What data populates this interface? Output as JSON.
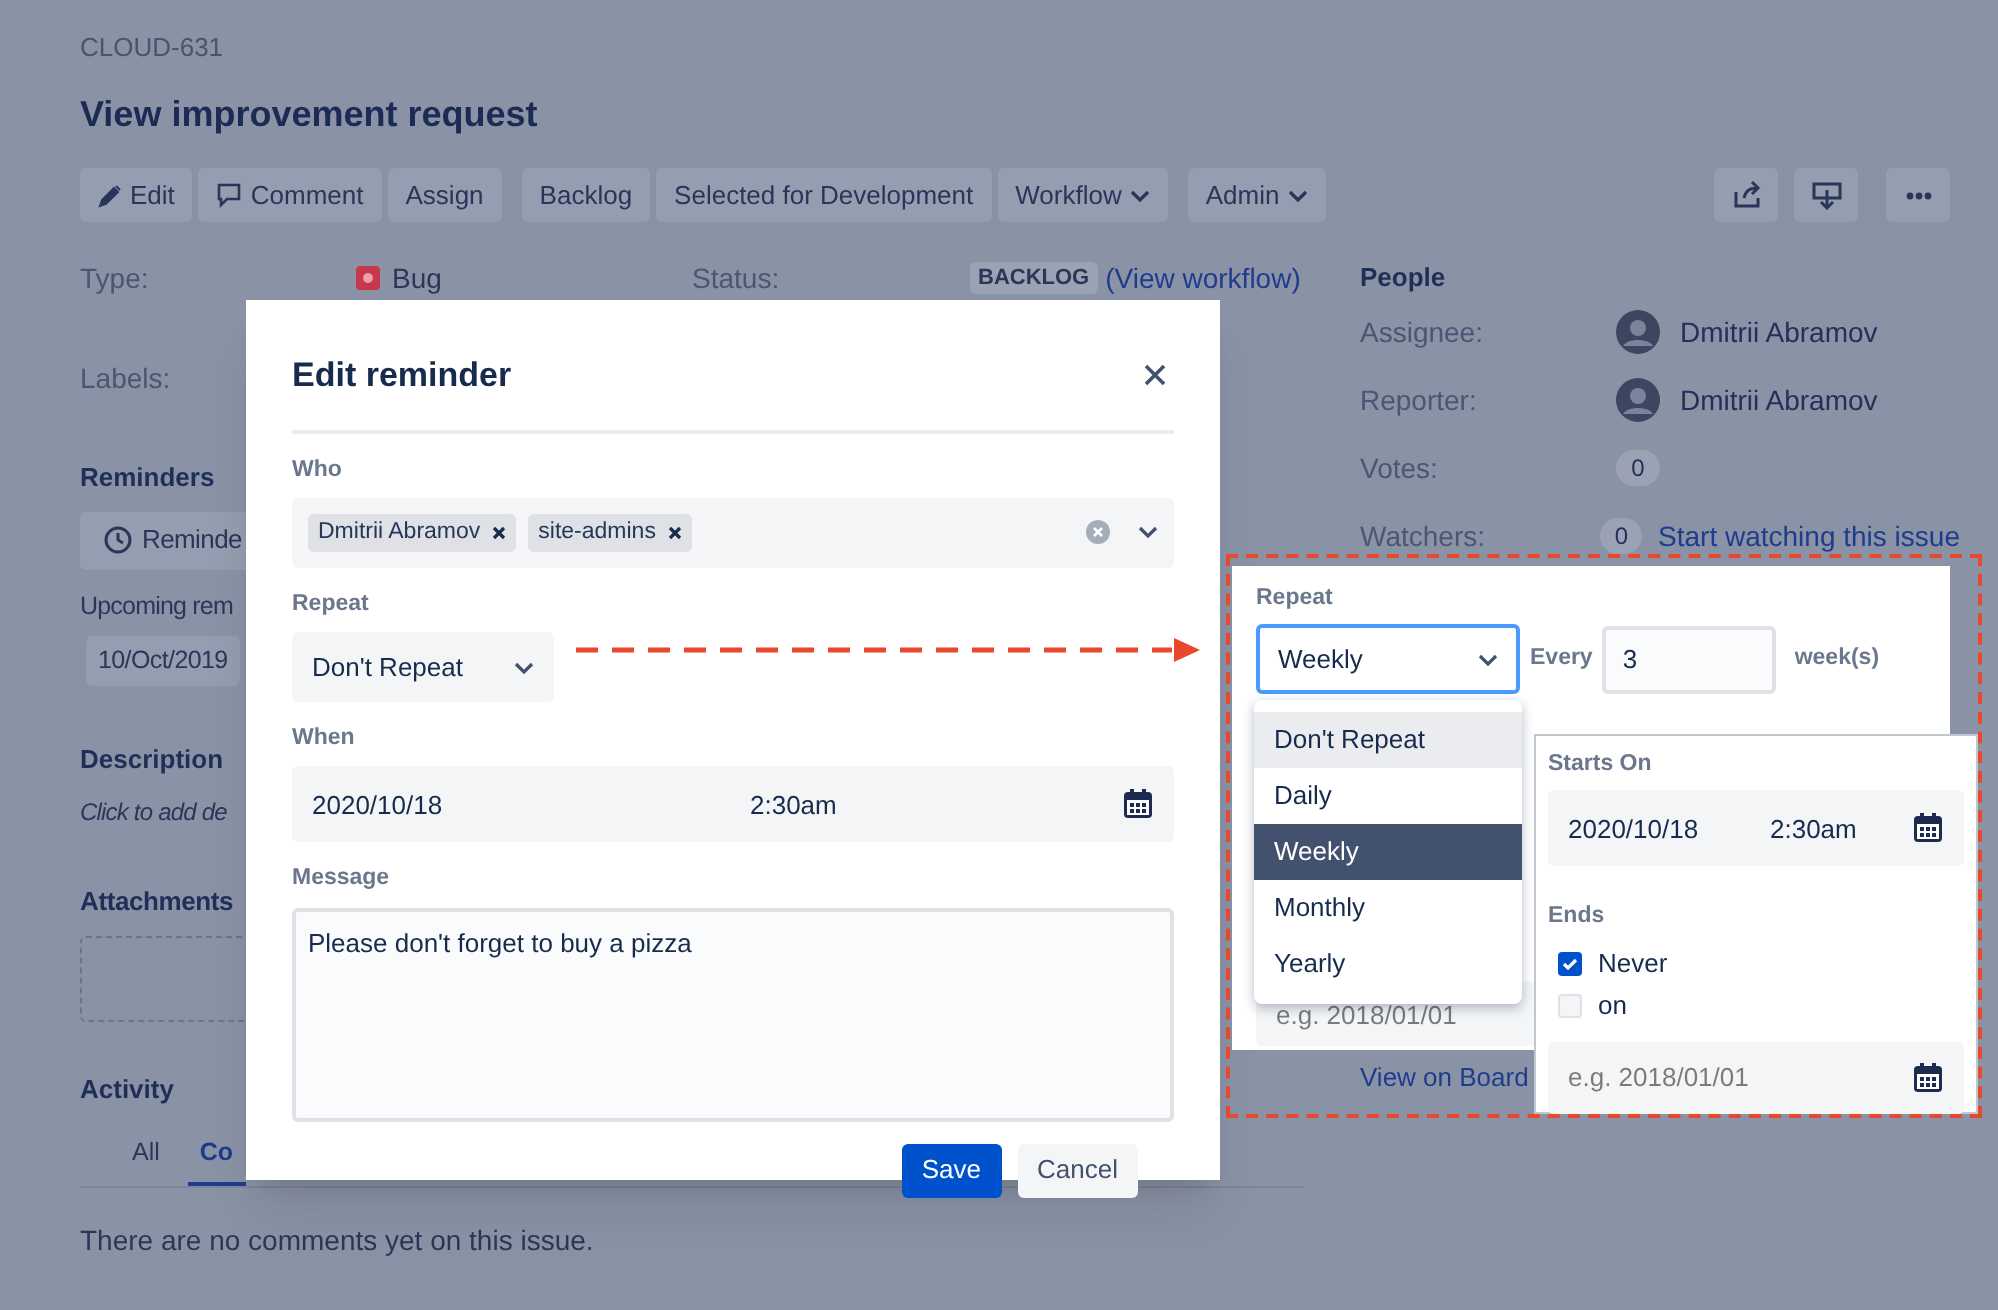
{
  "issue": {
    "key": "CLOUD-631",
    "title": "View improvement request"
  },
  "toolbar_groups": [
    [
      {
        "label": "Edit",
        "dropdown": false
      },
      {
        "label": "Comment",
        "dropdown": false
      },
      {
        "label": "Assign",
        "dropdown": false
      }
    ],
    [
      {
        "label": "Backlog",
        "dropdown": false
      },
      {
        "label": "Selected for Development",
        "dropdown": false
      },
      {
        "label": "Workflow",
        "dropdown": true
      }
    ],
    [
      {
        "label": "Admin",
        "dropdown": true
      }
    ]
  ],
  "fields": {
    "type": {
      "label": "Type:",
      "value": "Bug"
    },
    "status": {
      "label": "Status:",
      "badge": "BACKLOG",
      "link": "(View workflow)"
    },
    "labels": {
      "label": "Labels:"
    }
  },
  "reminders": {
    "heading": "Reminders",
    "button": "Reminde",
    "upcoming_label": "Upcoming rem",
    "upcoming_date": "10/Oct/2019"
  },
  "description": {
    "heading": "Description",
    "prompt": "Click to add de"
  },
  "attachments": {
    "heading": "Attachments"
  },
  "activity": {
    "heading": "Activity",
    "tabs": [
      {
        "label": "All",
        "selected": false
      },
      {
        "label": "Co",
        "selected": true
      }
    ],
    "empty_text": "There are no comments yet on this issue."
  },
  "people": {
    "heading": "People",
    "rows": [
      {
        "label": "Assignee:",
        "kind": "user",
        "value": "Dmitrii Abramov"
      },
      {
        "label": "Reporter:",
        "kind": "user",
        "value": "Dmitrii Abramov"
      },
      {
        "label": "Votes:",
        "kind": "count",
        "value": "0"
      },
      {
        "label": "Watchers:",
        "kind": "count",
        "value": "0",
        "link": "Start watching this issue"
      }
    ]
  },
  "modal": {
    "title": "Edit reminder",
    "who": {
      "label": "Who",
      "chips": [
        "Dmitrii Abramov",
        "site-admins"
      ]
    },
    "repeat": {
      "label": "Repeat",
      "value": "Don't Repeat"
    },
    "when": {
      "label": "When",
      "date": "2020/10/18",
      "time": "2:30am"
    },
    "message": {
      "label": "Message",
      "value": "Please don't forget to buy a pizza"
    },
    "buttons": [
      {
        "label": "Save",
        "kind": "primary"
      },
      {
        "label": "Cancel",
        "kind": "secondary"
      }
    ]
  },
  "callout": {
    "repeat_label": "Repeat",
    "repeat_value": "Weekly",
    "every_label": "Every",
    "every_value": "3",
    "unit": "week(s)",
    "options": [
      {
        "label": "Don't Repeat",
        "selected": false,
        "hovered": true
      },
      {
        "label": "Daily",
        "selected": false,
        "hovered": false
      },
      {
        "label": "Weekly",
        "selected": true,
        "hovered": false
      },
      {
        "label": "Monthly",
        "selected": false,
        "hovered": false
      },
      {
        "label": "Yearly",
        "selected": false,
        "hovered": false
      }
    ],
    "date_placeholder": "e.g. 2018/01/01",
    "link": "View on Board",
    "schedule": {
      "starts_label": "Starts On",
      "date": "2020/10/18",
      "time": "2:30am",
      "ends_label": "Ends",
      "ends_options": [
        {
          "label": "Never",
          "checked": true
        },
        {
          "label": "on",
          "checked": false
        }
      ],
      "end_date_placeholder": "e.g. 2018/01/01"
    }
  }
}
